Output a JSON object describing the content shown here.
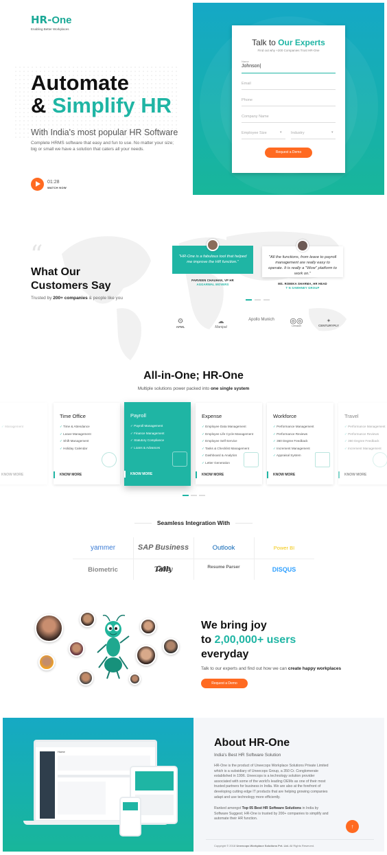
{
  "brand": {
    "logo_hr": "HR-",
    "logo_one": "One",
    "tagline": "Enabling Better Workplaces"
  },
  "hero": {
    "title_line1": "Automate",
    "title_line2_prefix": "& ",
    "title_line2_accent": "Simplify HR",
    "subtitle": "With India's most popular HR Software",
    "description": "Complete HRMS software that easy and fun to use. No matter your size; big or small we have a solution that caters all your needs.",
    "video_time": "01:28",
    "video_label": "WATCH NOW"
  },
  "form": {
    "title_prefix": "Talk to ",
    "title_accent": "Our Experts",
    "subtitle": "Find out why +200 Companies Trust HR-One",
    "name_label": "Name",
    "name_value": "Johnson|",
    "email_placeholder": "Email",
    "phone_placeholder": "Phone",
    "company_placeholder": "Company Name",
    "employee_size_placeholder": "Employee Size",
    "industry_placeholder": "Industry",
    "submit_label": "Request a Demo"
  },
  "testimonials": {
    "quote_mark": "“",
    "title_line1": "What Our",
    "title_line2": "Customers Say",
    "trusted_prefix": "Trusted by ",
    "trusted_bold": "200+ companies",
    "trusted_suffix": " & people like you",
    "items": [
      {
        "quote": "\"HR-One is a fabulous tool that helped me improve the HR function.\"",
        "name": "PARVEEN CHAUHAN, VP HR",
        "company": "AGGARWAL MOVERS"
      },
      {
        "quote": "\"All the functions, from leave to payroll management are really easy to operate. It is really a \"Wow\" platform to work on.\"",
        "name": "MS. ROMIKA SHARMA, HR HEAD",
        "company": "T N SAWHNEY GROUP"
      }
    ],
    "client_logos": [
      "APML",
      "Manipal",
      "Apollo Munich",
      "Lenskart",
      "CENTURYPLY"
    ]
  },
  "modules": {
    "title": "All-in-One; HR-One",
    "subtitle_prefix": "Multiple solutions power packed into ",
    "subtitle_bold": "one single system",
    "cta": "KNOW MORE",
    "cards": [
      {
        "title": "Time Office",
        "items": [
          "Time & Attendance",
          "Leave Management",
          "Shift Management",
          "Holiday Calendar"
        ]
      },
      {
        "title": "Payroll",
        "items": [
          "Payroll Management",
          "Finance Management",
          "Statutory Compliance",
          "Loans & Advances"
        ]
      },
      {
        "title": "Expense",
        "items": [
          "Employee Data Management",
          "Employee Life Cycle Management",
          "Employee Self-Service",
          "Tasks & Checklist Management",
          "Dashboard & Analytics",
          "Letter Generation"
        ]
      },
      {
        "title": "Workforce",
        "items": [
          "Performance Management",
          "Performance Reviews",
          "360 Degree Feedback",
          "Increment Management",
          "Appraisal System"
        ]
      },
      {
        "title": "Travel",
        "items": [
          "Performance Management",
          "Performance Reviews",
          "360 Degree Feedback",
          "Increment Management"
        ]
      }
    ],
    "left_partial": {
      "items": [
        "Management",
        "",
        "",
        "Management"
      ]
    }
  },
  "integrations": {
    "title": "Seamless Integration With",
    "row1": [
      "yammer",
      "SAP Business One",
      "Outlook",
      "Power BI"
    ],
    "row2": [
      "Biometric",
      "Tally",
      "Resume Parser",
      "DISQUS"
    ]
  },
  "joy": {
    "line1": "We bring joy",
    "line2_prefix": "to ",
    "line2_accent": "2,00,000+ users",
    "line3": "everyday",
    "sub_prefix": "Talk to our experts and find out how we can ",
    "sub_bold": "create happy workplaces",
    "cta": "Request a Demo"
  },
  "about": {
    "title": "About HR-One",
    "subtitle": "India's Best HR Software Solution",
    "para1": "HR-One is the product of Uneecops Workplace Solutions Private Limited which is a subsidiary of Uneecops Group, a 350 Cr. Conglomerate established in 1996. Uneecops is a technology solution provider associated with some of the world's leading OEMs as one of their most trusted partners for business in India. We are also at the forefront of developing cutting edge IT products that are helping growing companies adapt and use technology more efficiently.",
    "para2_prefix": "Ranked amongst ",
    "para2_bold": "Top 05 Best HR Software Solutions",
    "para2_suffix": " in India by Software Suggest; HR-One is trusted by 200+ companies to simplify and automate their HR function.",
    "copyright_prefix": "Copyright © 2018 ",
    "copyright_bold": "Uneecops Workplace Solutions Pvt. Ltd.",
    "copyright_suffix": " All Rights Reserved.",
    "scroll_top": "↑",
    "mock_screen_title": "Home"
  },
  "colors": {
    "accent": "#1fb5a4",
    "orange": "#ff6a21"
  }
}
